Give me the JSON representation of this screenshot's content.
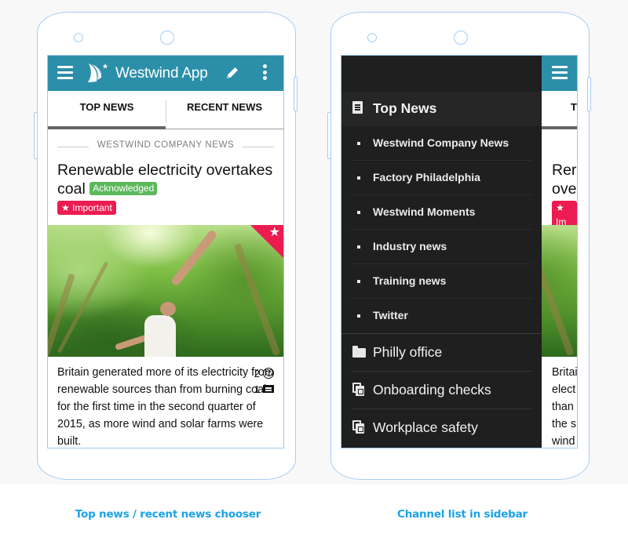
{
  "left_phone": {
    "appbar": {
      "title": "Westwind App",
      "icons": [
        "menu-icon",
        "westwind-logo-icon",
        "edit-pencil-icon",
        "more-vert-icon"
      ],
      "color": "#2b8fa9"
    },
    "tabs": [
      {
        "label": "TOP NEWS",
        "active": true
      },
      {
        "label": "RECENT NEWS",
        "active": false
      }
    ],
    "section_heading": "WESTWIND COMPANY NEWS",
    "article": {
      "title": "Renewable electricity overtakes coal",
      "acknowledged_badge": "Acknowledged",
      "important_badge": "Important",
      "important_icon": "star-icon",
      "image_alt": "Woman with raised arms in a sunlit green forest",
      "favorite_icon": "star-icon",
      "summary": "Britain generated more of its electricity from renewable sources than from burning coal for the first time in the second quarter of 2015, as more wind and solar farms were built.",
      "reactions": {
        "likes": "2",
        "comments": "1"
      }
    },
    "colors": {
      "acknowledged": "#5cb85c",
      "important": "#ec1c50"
    }
  },
  "right_phone": {
    "drawer": {
      "top_section": {
        "label": "Top News",
        "icon": "newspaper-icon"
      },
      "sub_items": [
        "Westwind Company News",
        "Factory Philadelphia",
        "Westwind Moments",
        "Industry news",
        "Training news",
        "Twitter"
      ],
      "main_items": [
        {
          "label": "Philly office",
          "icon": "folder-icon"
        },
        {
          "label": "Onboarding checks",
          "icon": "checklist-doc-icon"
        },
        {
          "label": "Workplace safety",
          "icon": "checklist-doc-icon"
        }
      ]
    },
    "behind": {
      "tab_initial": "T",
      "title_fragment_1": "Rer",
      "title_fragment_2": "ove",
      "important_fragment": "Im",
      "summary_fragments": [
        "Britai",
        "elect",
        "than",
        "the s",
        "wind"
      ]
    }
  },
  "captions": {
    "left": "Top news / recent news chooser",
    "right": "Channel list in sidebar"
  }
}
